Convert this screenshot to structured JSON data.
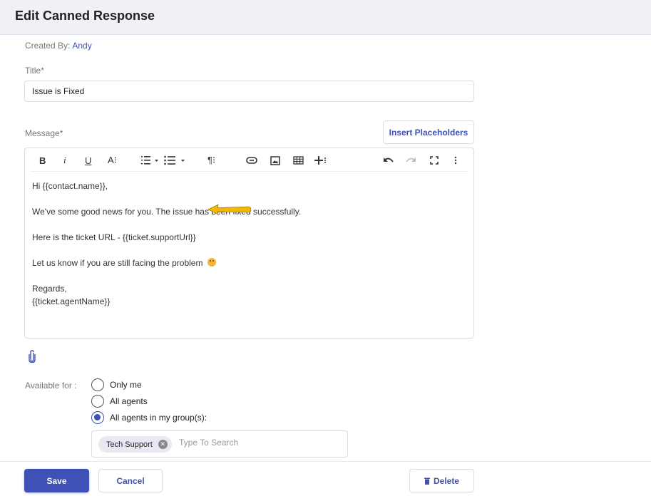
{
  "header": {
    "title": "Edit Canned Response"
  },
  "created_by": {
    "label": "Created By:",
    "value": "Andy"
  },
  "title_field": {
    "label": "Title*",
    "value": "Issue is Fixed"
  },
  "message_field": {
    "label": "Message*",
    "insert_placeholders_label": "Insert Placeholders",
    "toolbar": [
      {
        "name": "bold",
        "glyph": "B"
      },
      {
        "name": "italic",
        "glyph": "i"
      },
      {
        "name": "underline",
        "glyph": "U"
      },
      {
        "name": "font-size",
        "glyph": "A⁝"
      },
      {
        "name": "ordered-list"
      },
      {
        "name": "unordered-list"
      },
      {
        "name": "paragraph-format",
        "glyph": "¶⁝"
      },
      {
        "name": "link"
      },
      {
        "name": "image"
      },
      {
        "name": "table"
      },
      {
        "name": "insert-more"
      },
      {
        "name": "undo"
      },
      {
        "name": "redo"
      },
      {
        "name": "fullscreen"
      },
      {
        "name": "more-options"
      }
    ],
    "content": {
      "line1": "Hi {{contact.name}},",
      "line2": "We've some good news for you. The issue has been fixed successfully.",
      "line3": "Here is the ticket URL - {{ticket.supportUrl}}",
      "line4": "Let us know if you are still facing the problem",
      "line5": "Regards,",
      "line6": "{{ticket.agentName}}"
    },
    "annotation_arrow_color": "#f5b800"
  },
  "attachment": {
    "icon": "paperclip-icon"
  },
  "availability": {
    "label": "Available for :",
    "options": [
      {
        "label": "Only me",
        "selected": false
      },
      {
        "label": "All agents",
        "selected": false
      },
      {
        "label": "All agents in my group(s):",
        "selected": true
      }
    ],
    "groups": {
      "selected": [
        "Tech Support"
      ],
      "placeholder": "Type To Search"
    }
  },
  "footer": {
    "save_label": "Save",
    "cancel_label": "Cancel",
    "delete_label": "Delete"
  },
  "colors": {
    "accent": "#3f51b5",
    "header_bg": "#f0f1f7"
  }
}
